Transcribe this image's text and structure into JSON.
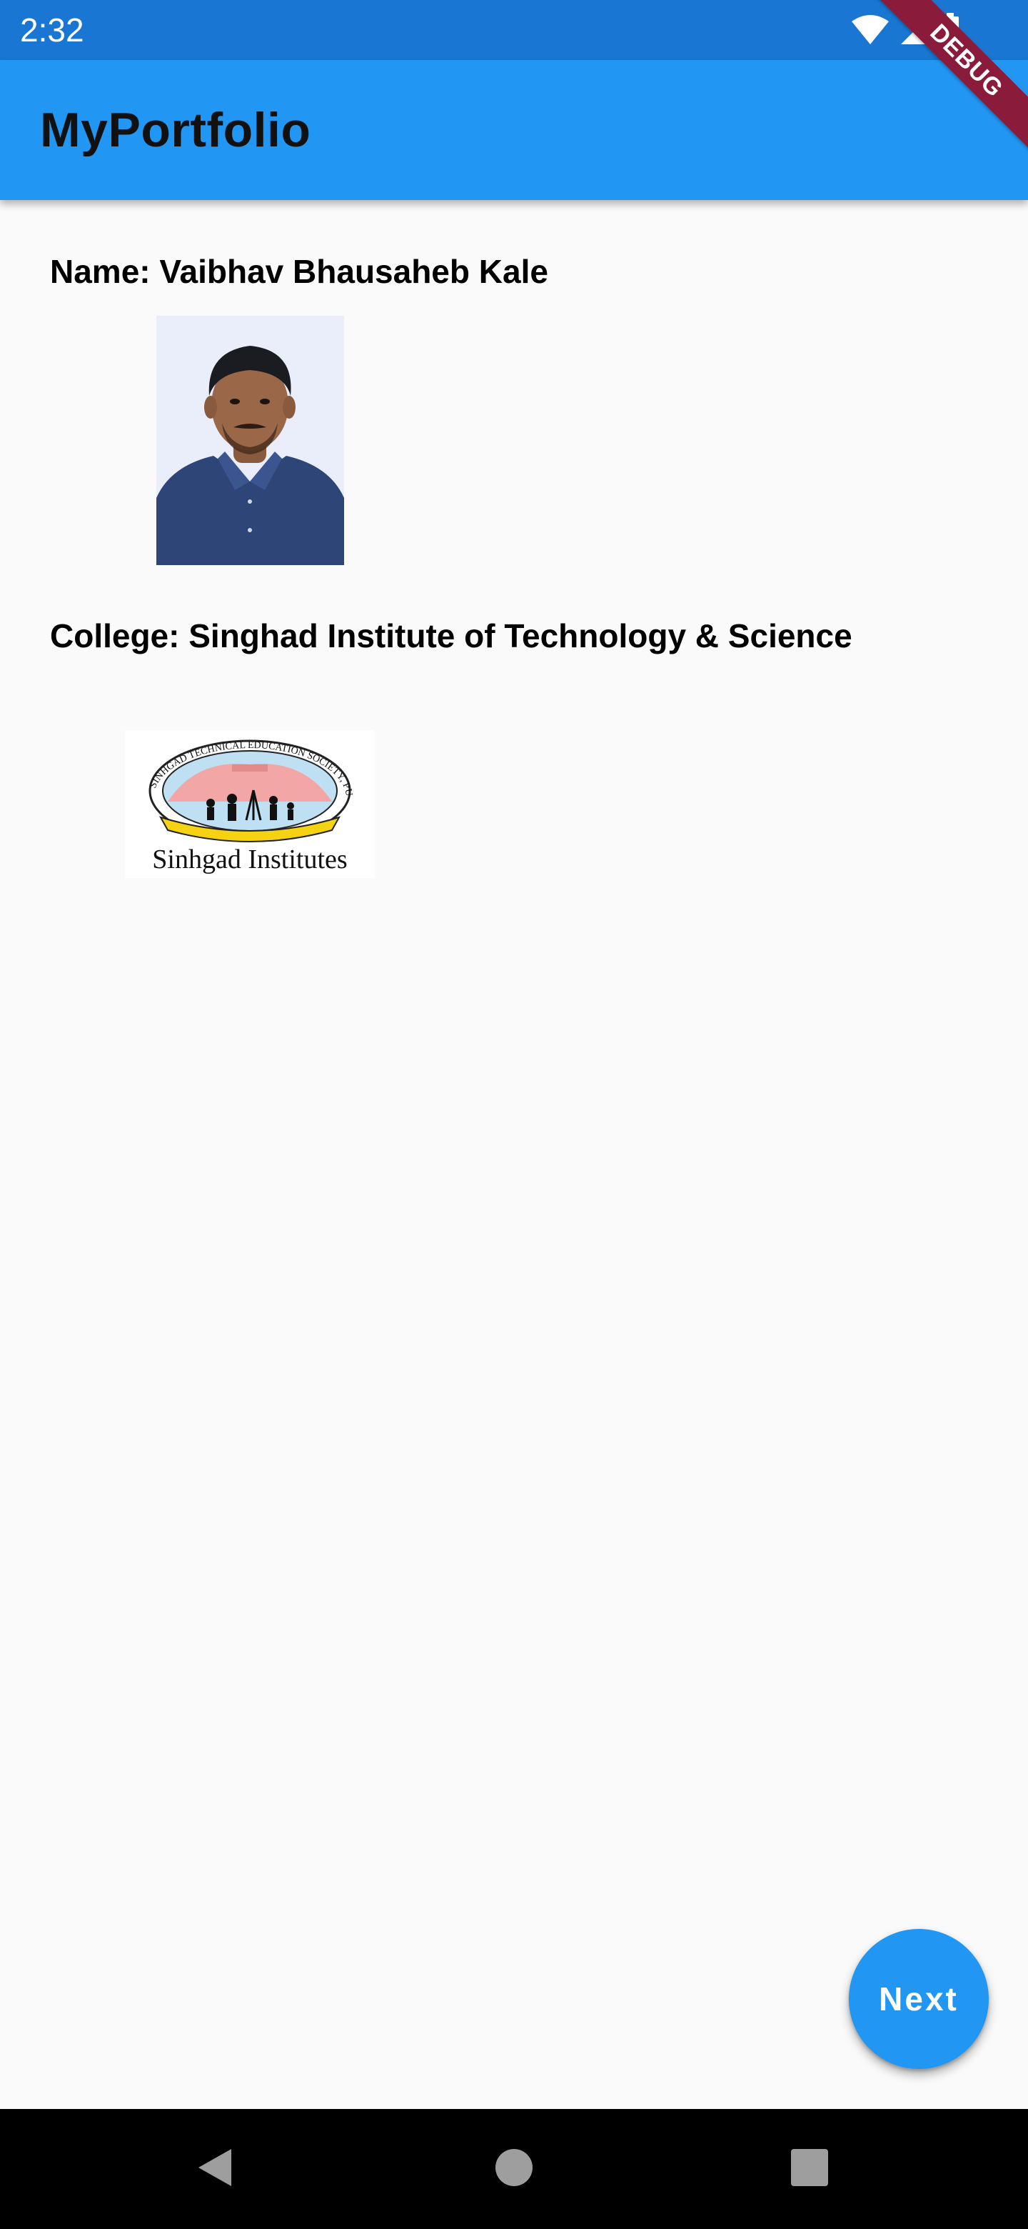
{
  "status_bar": {
    "time": "2:32",
    "icons": [
      "wifi-icon",
      "signal-icon",
      "battery-icon"
    ]
  },
  "debug_banner": {
    "label": "DEBUG",
    "color": "#8a1b3a"
  },
  "app_bar": {
    "title": "MyPortfolio",
    "color": "#2196f3"
  },
  "profile": {
    "name_label": "Name: Vaibhav Bhausaheb Kale",
    "college_label": "College: Singhad Institute of Technology & Science",
    "logo_caption": "Sinhgad Institutes",
    "logo_ring_text": "SINHGAD TECHNICAL EDUCATION SOCIETY, PUNE"
  },
  "fab": {
    "label": "Next",
    "color": "#2196f3"
  },
  "nav_bar": {
    "buttons": [
      "back-icon",
      "home-icon",
      "recents-icon"
    ]
  }
}
